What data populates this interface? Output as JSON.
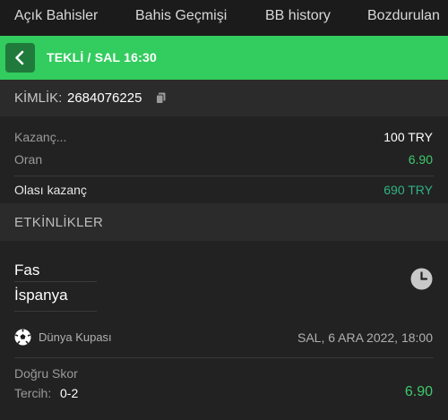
{
  "tabs": [
    {
      "label": "Açık Bahisler"
    },
    {
      "label": "Bahis Geçmişi"
    },
    {
      "label": "BB history"
    },
    {
      "label": "Bozdurulan"
    }
  ],
  "header": {
    "title": "TEKLİ / SAL 16:30"
  },
  "bet_id": {
    "label": "KİMLİK:",
    "value": "2684076225"
  },
  "summary": {
    "stake_label": "Kazanç...",
    "stake_value": "100 TRY",
    "odds_label": "Oran",
    "odds_value": "6.90",
    "potential_label": "Olası kazanç",
    "potential_value": "690 TRY"
  },
  "events_title": "ETKİNLİKLER",
  "event": {
    "home": "Fas",
    "away": "İspanya",
    "competition": "Dünya Kupası",
    "date": "SAL, 6 ARA 2022, 18:00",
    "market": "Doğru Skor",
    "pick_label": "Tercih:",
    "pick_value": "0-2",
    "pick_odds": "6.90"
  },
  "icons": {
    "back": "chevron-left-icon",
    "copy": "copy-icon",
    "clock": "clock-icon",
    "competition": "soccer-ball-icon"
  },
  "colors": {
    "accent_green": "#33cc5e",
    "odds_green": "#3ec96b",
    "background": "#1b1b1b"
  }
}
